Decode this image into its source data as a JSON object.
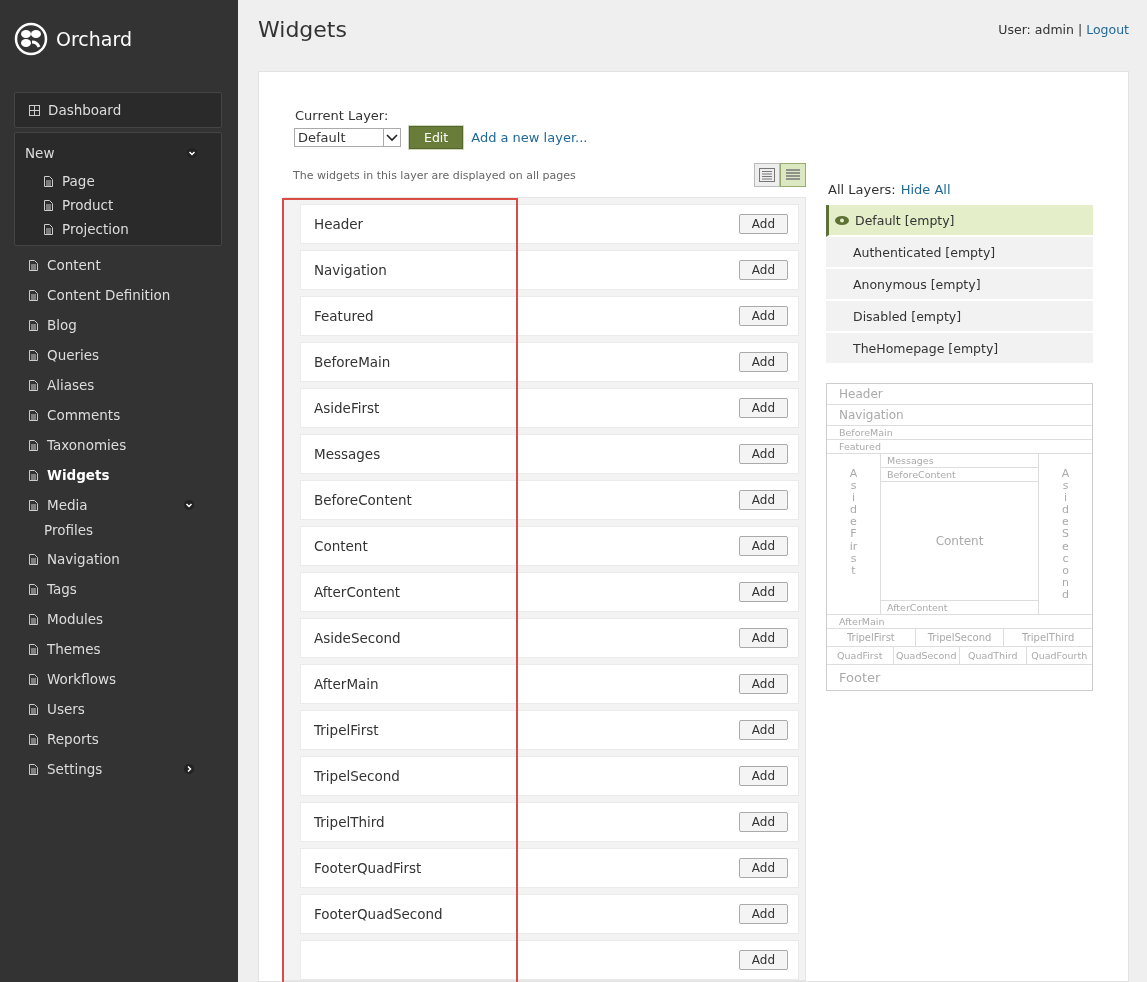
{
  "brand": {
    "name": "Orchard"
  },
  "sidebar": {
    "items": [
      {
        "label": "Dashboard",
        "kind": "boxed",
        "selected": false
      },
      {
        "label": "New",
        "kind": "group",
        "expanded": true,
        "children": [
          {
            "label": "Page"
          },
          {
            "label": "Product"
          },
          {
            "label": "Projection"
          }
        ]
      },
      {
        "label": "Content",
        "kind": "link",
        "selected": false
      },
      {
        "label": "Content Definition",
        "kind": "link",
        "selected": false
      },
      {
        "label": "Blog",
        "kind": "link",
        "selected": false
      },
      {
        "label": "Queries",
        "kind": "link",
        "selected": false
      },
      {
        "label": "Aliases",
        "kind": "link",
        "selected": false
      },
      {
        "label": "Comments",
        "kind": "link",
        "selected": false
      },
      {
        "label": "Taxonomies",
        "kind": "link",
        "selected": false
      },
      {
        "label": "Widgets",
        "kind": "link",
        "selected": true
      },
      {
        "label": "Media",
        "kind": "link",
        "selected": false,
        "expanded": true,
        "children": [
          {
            "label": "Profiles"
          }
        ]
      },
      {
        "label": "Navigation",
        "kind": "link",
        "selected": false
      },
      {
        "label": "Tags",
        "kind": "link",
        "selected": false
      },
      {
        "label": "Modules",
        "kind": "link",
        "selected": false
      },
      {
        "label": "Themes",
        "kind": "link",
        "selected": false
      },
      {
        "label": "Workflows",
        "kind": "link",
        "selected": false
      },
      {
        "label": "Users",
        "kind": "link",
        "selected": false
      },
      {
        "label": "Reports",
        "kind": "link",
        "selected": false
      },
      {
        "label": "Settings",
        "kind": "link",
        "selected": false,
        "expanded": false
      }
    ]
  },
  "header": {
    "title": "Widgets",
    "user_label": "User: admin",
    "separator": "|",
    "logout": "Logout"
  },
  "layer_picker": {
    "label": "Current Layer:",
    "value": "Default",
    "edit_button": "Edit",
    "add_link": "Add a new layer...",
    "description": "The widgets in this layer are displayed on all pages"
  },
  "view_toggles": [
    {
      "selected": false
    },
    {
      "selected": true
    }
  ],
  "zones": [
    {
      "name": "Header",
      "button": "Add"
    },
    {
      "name": "Navigation",
      "button": "Add"
    },
    {
      "name": "Featured",
      "button": "Add"
    },
    {
      "name": "BeforeMain",
      "button": "Add"
    },
    {
      "name": "AsideFirst",
      "button": "Add"
    },
    {
      "name": "Messages",
      "button": "Add"
    },
    {
      "name": "BeforeContent",
      "button": "Add"
    },
    {
      "name": "Content",
      "button": "Add"
    },
    {
      "name": "AfterContent",
      "button": "Add"
    },
    {
      "name": "AsideSecond",
      "button": "Add"
    },
    {
      "name": "AfterMain",
      "button": "Add"
    },
    {
      "name": "TripelFirst",
      "button": "Add"
    },
    {
      "name": "TripelSecond",
      "button": "Add"
    },
    {
      "name": "TripelThird",
      "button": "Add"
    },
    {
      "name": "FooterQuadFirst",
      "button": "Add"
    },
    {
      "name": "FooterQuadSecond",
      "button": "Add"
    },
    {
      "button": "Add"
    }
  ],
  "highlight_frame": true,
  "layers": {
    "label": "All Layers:",
    "toggle": "Hide All",
    "items": [
      {
        "label": "Default [empty]",
        "selected": true
      },
      {
        "label": "Authenticated [empty]",
        "selected": false
      },
      {
        "label": "Anonymous [empty]",
        "selected": false
      },
      {
        "label": "Disabled [empty]",
        "selected": false
      },
      {
        "label": "TheHomepage [empty]",
        "selected": false
      }
    ]
  },
  "zone_map": {
    "header": "Header",
    "navigation": "Navigation",
    "before_main": "BeforeMain",
    "featured": "Featured",
    "aside_first": "AsideFirst",
    "messages": "Messages",
    "before_content": "BeforeContent",
    "content": "Content",
    "after_content": "AfterContent",
    "aside_second": "AsideSecond",
    "after_main": "AfterMain",
    "tripel": [
      "TripelFirst",
      "TripelSecond",
      "TripelThird"
    ],
    "quad": [
      "QuadFirst",
      "QuadSecond",
      "QuadThird",
      "QuadFourth"
    ],
    "footer": "Footer"
  }
}
